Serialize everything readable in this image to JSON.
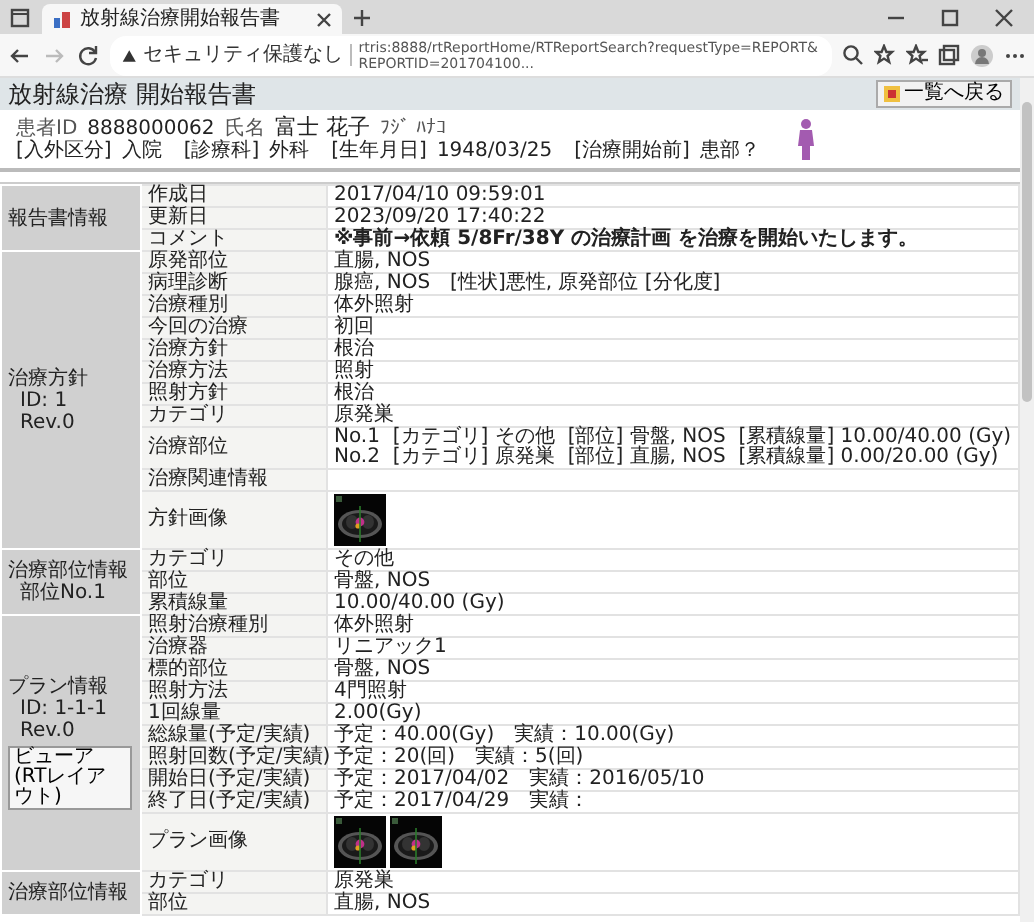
{
  "browser": {
    "tab_title": "放射線治療開始報告書",
    "security": "セキュリティ保護なし",
    "url": "rtris:8888/rtReportHome/RTReportSearch?requestType=REPORT&REPORTID=201704100..."
  },
  "page": {
    "title": "放射線治療 開始報告書",
    "top_button": "一覧へ戻る"
  },
  "patient": {
    "id_label": "患者ID",
    "id": "8888000062",
    "name_label": "氏名",
    "name": "富士 花子",
    "kana": "ﾌｼﾞ ﾊﾅｺ",
    "info": [
      {
        "label": "[入外区分]",
        "value": "入院"
      },
      {
        "label": "[診療科]",
        "value": "外科"
      },
      {
        "label": "[生年月日]",
        "value": "1948/03/25"
      },
      {
        "label": "[治療開始前]",
        "value": "患部？"
      }
    ]
  },
  "sections": [
    {
      "labels": [
        "報告書情報"
      ],
      "rows": [
        {
          "kind": "text",
          "label": "作成日",
          "value": "2017/04/10 09:59:01"
        },
        {
          "kind": "text",
          "label": "更新日",
          "value": "2023/09/20 17:40:22"
        },
        {
          "kind": "comment",
          "label": "コメント",
          "value": "※事前→依頼 5/8Fr/38Y の治療計画 を治療を開始いたします。"
        }
      ]
    },
    {
      "labels": [
        "治療方針",
        "ID: 1",
        "Rev.0"
      ],
      "rows": [
        {
          "kind": "text",
          "label": "原発部位",
          "value": "直腸, NOS"
        },
        {
          "kind": "text",
          "label": "病理診断",
          "value": "腺癌, NOS　[性状]悪性, 原発部位 [分化度]"
        },
        {
          "kind": "text",
          "label": "治療種別",
          "value": "体外照射"
        },
        {
          "kind": "text",
          "label": "今回の治療",
          "value": "初回"
        },
        {
          "kind": "text",
          "label": "治療方針",
          "value": "根治"
        },
        {
          "kind": "text",
          "label": "治療方法",
          "value": "照射"
        },
        {
          "kind": "text",
          "label": "照射方針",
          "value": "根治"
        },
        {
          "kind": "text",
          "label": "カテゴリ",
          "value": "原発巣"
        },
        {
          "kind": "sites",
          "label": "治療部位",
          "sites": [
            {
              "no": "No.1",
              "category": "[カテゴリ] その他",
              "site": "[部位] 骨盤, NOS",
              "dose": "[累積線量] 10.00/40.00 (Gy)"
            },
            {
              "no": "No.2",
              "category": "[カテゴリ] 原発巣",
              "site": "[部位] 直腸, NOS",
              "dose": "[累積線量] 0.00/20.00 (Gy)"
            }
          ]
        },
        {
          "kind": "text",
          "label": "治療関連情報"
        },
        {
          "kind": "images",
          "label": "方針画像"
        }
      ]
    },
    {
      "labels": [
        "治療部位情報",
        "部位No.1"
      ],
      "rows": [
        {
          "kind": "text",
          "label": "カテゴリ",
          "value": "その他"
        },
        {
          "kind": "text",
          "label": "部位",
          "value": "骨盤, NOS"
        },
        {
          "kind": "text",
          "label": "累積線量",
          "value": "10.00/40.00 (Gy)"
        }
      ]
    },
    {
      "labels": [
        "プラン情報",
        "ID: 1-1-1",
        "Rev.0"
      ],
      "button": "ビューア(RTレイアウト)",
      "rows": [
        {
          "kind": "text",
          "label": "照射治療種別",
          "value": "体外照射"
        },
        {
          "kind": "text",
          "label": "治療器",
          "value": "リニアック1"
        },
        {
          "kind": "text",
          "label": "標的部位",
          "value": "骨盤, NOS"
        },
        {
          "kind": "text",
          "label": "照射方法",
          "value": "4門照射"
        },
        {
          "kind": "text",
          "label": "1回線量",
          "value": "2.00(Gy)"
        },
        {
          "kind": "text",
          "label": "総線量(予定/実績)",
          "value": "予定：40.00(Gy)　実績：10.00(Gy)"
        },
        {
          "kind": "text",
          "label": "照射回数(予定/実績)",
          "value": "予定：20(回)　実績：5(回)"
        },
        {
          "kind": "text",
          "label": "開始日(予定/実績)",
          "value": "予定：2017/04/02　実績：2016/05/10"
        },
        {
          "kind": "text",
          "label": "終了日(予定/実績)",
          "value": "予定：2017/04/29　実績："
        },
        {
          "kind": "images",
          "label": "プラン画像"
        }
      ]
    },
    {
      "labels": [
        "治療部位情報"
      ],
      "rows": [
        {
          "kind": "text",
          "label": "カテゴリ",
          "value": "原発巣"
        },
        {
          "kind": "text",
          "label": "部位",
          "value": "直腸, NOS"
        }
      ]
    }
  ]
}
